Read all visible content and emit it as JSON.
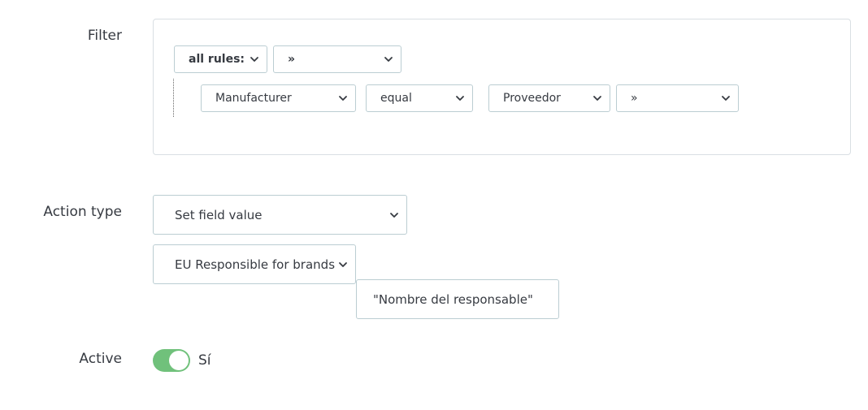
{
  "form": {
    "filter_label": "Filter",
    "action_type_label": "Action type",
    "active_label": "Active"
  },
  "filter": {
    "group_operator": "all rules:",
    "group_add": "»",
    "rule": {
      "field": "Manufacturer",
      "operator": "equal",
      "value": "Proveedor",
      "add": "»"
    }
  },
  "action": {
    "type": "Set field value",
    "field": "EU Responsible for brands",
    "value": "\"Nombre del responsable\""
  },
  "active": {
    "state_label": "Sí",
    "on": true
  },
  "colors": {
    "toggle_on": "#70c17b",
    "border": "#bbcdd2",
    "text": "#363a41"
  },
  "icons": {
    "select_arrow": "chevron-down-icon"
  }
}
